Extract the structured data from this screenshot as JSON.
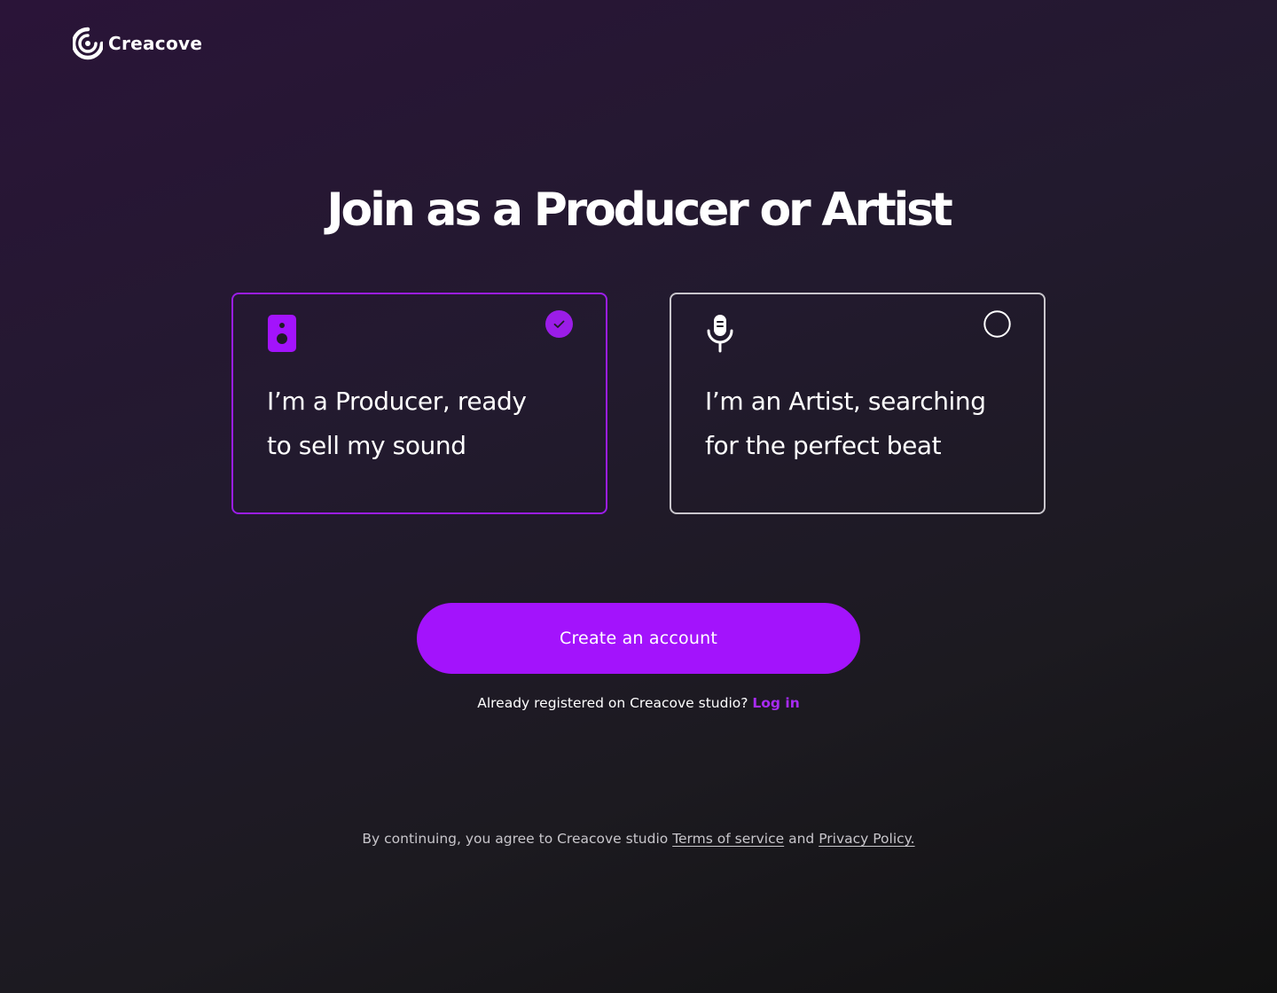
{
  "brand": {
    "name": "Creacove",
    "logo_icon": "creacove-logo-icon",
    "accent_color": "#a313fc"
  },
  "title": "Join as a Producer or Artist",
  "roles": [
    {
      "id": "producer",
      "line1": "I’m a Producer, ready",
      "line2": "to sell my sound",
      "icon": "speaker-icon",
      "selected": true
    },
    {
      "id": "artist",
      "line1": "I’m an Artist, searching",
      "line2": "for the perfect beat",
      "icon": "microphone-icon",
      "selected": false
    }
  ],
  "cta": {
    "label": "Create an account"
  },
  "login": {
    "prompt": "Already registered on Creacove studio?",
    "link_label": "Log in"
  },
  "legal": {
    "prefix": "By continuing, you agree to Creacove studio",
    "terms_label": "Terms of service",
    "conjunction": "and",
    "privacy_label": "Privacy Policy."
  }
}
